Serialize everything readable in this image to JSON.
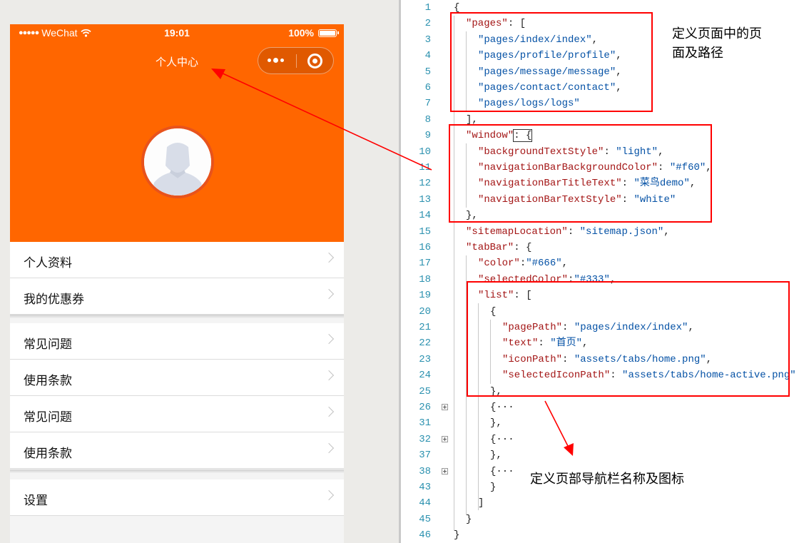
{
  "phone": {
    "status": {
      "signal": "●●●●●",
      "carrier": "WeChat",
      "time": "19:01",
      "battery": "100%"
    },
    "nav_title": "个人中心",
    "menu_groups": [
      [
        "个人资料",
        "我的优惠券"
      ],
      [
        "常见问题",
        "使用条款",
        "常见问题",
        "使用条款"
      ],
      [
        "设置"
      ]
    ],
    "colors": {
      "nav_bg": "#ff6600"
    }
  },
  "editor": {
    "lines": [
      {
        "n": "1",
        "tokens": [
          [
            "p",
            "{"
          ]
        ]
      },
      {
        "n": "2",
        "tokens": [
          [
            "k",
            "\"pages\""
          ],
          [
            "p",
            ": ["
          ]
        ]
      },
      {
        "n": "3",
        "tokens": [
          [
            "s",
            "\"pages/index/index\""
          ],
          [
            "p",
            ","
          ]
        ]
      },
      {
        "n": "4",
        "tokens": [
          [
            "s",
            "\"pages/profile/profile\""
          ],
          [
            "p",
            ","
          ]
        ]
      },
      {
        "n": "5",
        "tokens": [
          [
            "s",
            "\"pages/message/message\""
          ],
          [
            "p",
            ","
          ]
        ]
      },
      {
        "n": "6",
        "tokens": [
          [
            "s",
            "\"pages/contact/contact\""
          ],
          [
            "p",
            ","
          ]
        ]
      },
      {
        "n": "7",
        "tokens": [
          [
            "s",
            "\"pages/logs/logs\""
          ]
        ]
      },
      {
        "n": "8",
        "tokens": [
          [
            "p",
            "],"
          ]
        ]
      },
      {
        "n": "9",
        "tokens": [
          [
            "k",
            "\"window\""
          ],
          [
            "p",
            ": {"
          ]
        ]
      },
      {
        "n": "10",
        "tokens": [
          [
            "k",
            "\"backgroundTextStyle\""
          ],
          [
            "p",
            ": "
          ],
          [
            "s",
            "\"light\""
          ],
          [
            "p",
            ","
          ]
        ]
      },
      {
        "n": "11",
        "tokens": [
          [
            "k",
            "\"navigationBarBackgroundColor\""
          ],
          [
            "p",
            ": "
          ],
          [
            "s",
            "\"#f60\""
          ],
          [
            "p",
            ","
          ]
        ]
      },
      {
        "n": "12",
        "tokens": [
          [
            "k",
            "\"navigationBarTitleText\""
          ],
          [
            "p",
            ": "
          ],
          [
            "s",
            "\"菜鸟demo\""
          ],
          [
            "p",
            ","
          ]
        ]
      },
      {
        "n": "13",
        "tokens": [
          [
            "k",
            "\"navigationBarTextStyle\""
          ],
          [
            "p",
            ": "
          ],
          [
            "s",
            "\"white\""
          ]
        ]
      },
      {
        "n": "14",
        "tokens": [
          [
            "p",
            "},"
          ]
        ]
      },
      {
        "n": "15",
        "tokens": [
          [
            "k",
            "\"sitemapLocation\""
          ],
          [
            "p",
            ": "
          ],
          [
            "s",
            "\"sitemap.json\""
          ],
          [
            "p",
            ","
          ]
        ]
      },
      {
        "n": "16",
        "tokens": [
          [
            "k",
            "\"tabBar\""
          ],
          [
            "p",
            ": {"
          ]
        ]
      },
      {
        "n": "17",
        "tokens": [
          [
            "k",
            "\"color\""
          ],
          [
            "p",
            ":"
          ],
          [
            "s",
            "\"#666\""
          ],
          [
            "p",
            ","
          ]
        ]
      },
      {
        "n": "18",
        "tokens": [
          [
            "k",
            "\"selectedColor\""
          ],
          [
            "p",
            ":"
          ],
          [
            "s",
            "\"#333\""
          ],
          [
            "p",
            ","
          ]
        ]
      },
      {
        "n": "19",
        "tokens": [
          [
            "k",
            "\"list\""
          ],
          [
            "p",
            ": ["
          ]
        ]
      },
      {
        "n": "20",
        "tokens": [
          [
            "p",
            "{"
          ]
        ]
      },
      {
        "n": "21",
        "tokens": [
          [
            "k",
            "\"pagePath\""
          ],
          [
            "p",
            ": "
          ],
          [
            "s",
            "\"pages/index/index\""
          ],
          [
            "p",
            ","
          ]
        ]
      },
      {
        "n": "22",
        "tokens": [
          [
            "k",
            "\"text\""
          ],
          [
            "p",
            ": "
          ],
          [
            "s",
            "\"首页\""
          ],
          [
            "p",
            ","
          ]
        ]
      },
      {
        "n": "23",
        "tokens": [
          [
            "k",
            "\"iconPath\""
          ],
          [
            "p",
            ": "
          ],
          [
            "s",
            "\"assets/tabs/home.png\""
          ],
          [
            "p",
            ","
          ]
        ]
      },
      {
        "n": "24",
        "tokens": [
          [
            "k",
            "\"selectedIconPath\""
          ],
          [
            "p",
            ": "
          ],
          [
            "s",
            "\"assets/tabs/home-active.png\""
          ]
        ]
      },
      {
        "n": "25",
        "tokens": [
          [
            "p",
            "},"
          ]
        ]
      },
      {
        "n": "26",
        "tokens": [
          [
            "p",
            "{···"
          ]
        ]
      },
      {
        "n": "31",
        "tokens": [
          [
            "p",
            "},"
          ]
        ]
      },
      {
        "n": "32",
        "tokens": [
          [
            "p",
            "{···"
          ]
        ]
      },
      {
        "n": "37",
        "tokens": [
          [
            "p",
            "},"
          ]
        ]
      },
      {
        "n": "38",
        "tokens": [
          [
            "p",
            "{···"
          ]
        ]
      },
      {
        "n": "43",
        "tokens": [
          [
            "p",
            "}"
          ]
        ]
      },
      {
        "n": "44",
        "tokens": [
          [
            "p",
            "]"
          ]
        ]
      },
      {
        "n": "45",
        "tokens": [
          [
            "p",
            "}"
          ]
        ]
      },
      {
        "n": "46",
        "tokens": [
          [
            "p",
            "}"
          ]
        ]
      }
    ],
    "syntax_colors": {
      "key": "#a31515",
      "string": "#0451a5",
      "line_number": "#2b91af"
    }
  },
  "annotations": {
    "pages_note": "定义页面中的页\n面及路径",
    "tabbar_note": "定义页部导航栏名称及图标",
    "highlight_color": "#ff0000"
  }
}
